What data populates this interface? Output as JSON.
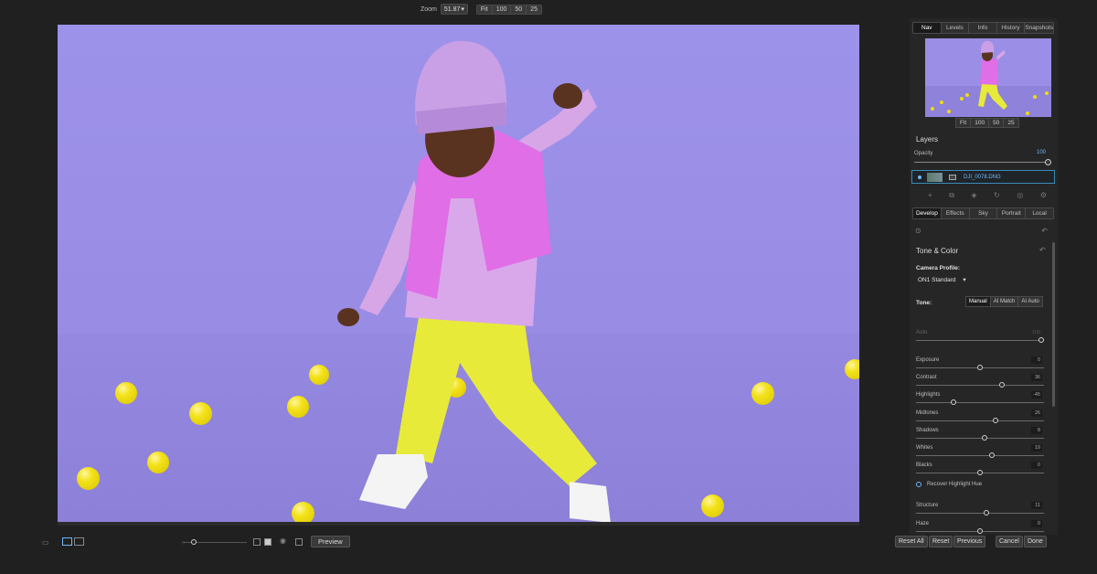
{
  "toolbar": {
    "zoom_label": "Zoom",
    "zoom_value": "51.87",
    "zoom_presets": [
      "Fit",
      "100",
      "50",
      "25"
    ]
  },
  "panel": {
    "nav_tabs": [
      "Nav",
      "Levels",
      "Info",
      "History",
      "Snapshots"
    ],
    "nav_active": "Nav",
    "thumb_zoom": [
      "Fit",
      "100",
      "50",
      "25"
    ],
    "layers": {
      "title": "Layers",
      "opacity_label": "Opacity",
      "opacity_value": "100",
      "layer_name": "DJI_0078.DNG"
    },
    "dev_tabs": [
      "Develop",
      "Effects",
      "Sky",
      "Portrait",
      "Local"
    ],
    "dev_active": "Develop",
    "tone_color": {
      "title": "Tone & Color",
      "camera_profile_label": "Camera Profile:",
      "camera_profile_value": "ON1 Standard",
      "tone_label": "Tone:",
      "tone_modes": [
        "Manual",
        "AI Match",
        "AI Auto"
      ],
      "tone_active": "Manual",
      "auto": {
        "label": "Auto",
        "value": "100",
        "level": 1.0
      },
      "sliders": [
        {
          "label": "Exposure",
          "value": "0",
          "level": 0.5
        },
        {
          "label": "Contrast",
          "value": "36",
          "level": 0.68
        },
        {
          "label": "Highlights",
          "value": "-45",
          "level": 0.28
        },
        {
          "label": "Midtones",
          "value": "26",
          "level": 0.63
        },
        {
          "label": "Shadows",
          "value": "8",
          "level": 0.54
        },
        {
          "label": "Whites",
          "value": "19",
          "level": 0.6
        },
        {
          "label": "Blacks",
          "value": "0",
          "level": 0.5
        }
      ],
      "recover_label": "Recover Highlight Hue",
      "sliders2": [
        {
          "label": "Structure",
          "value": "11",
          "level": 0.55
        },
        {
          "label": "Haze",
          "value": "0",
          "level": 0.5
        }
      ]
    }
  },
  "bottom": {
    "preview_label": "Preview",
    "buttons": [
      "Reset All",
      "Reset",
      "Previous",
      "Cancel",
      "Done"
    ]
  },
  "colors": {
    "accent": "#6fb8ff",
    "backdrop": "#9a8ee6",
    "balls": "#f3e21a"
  }
}
